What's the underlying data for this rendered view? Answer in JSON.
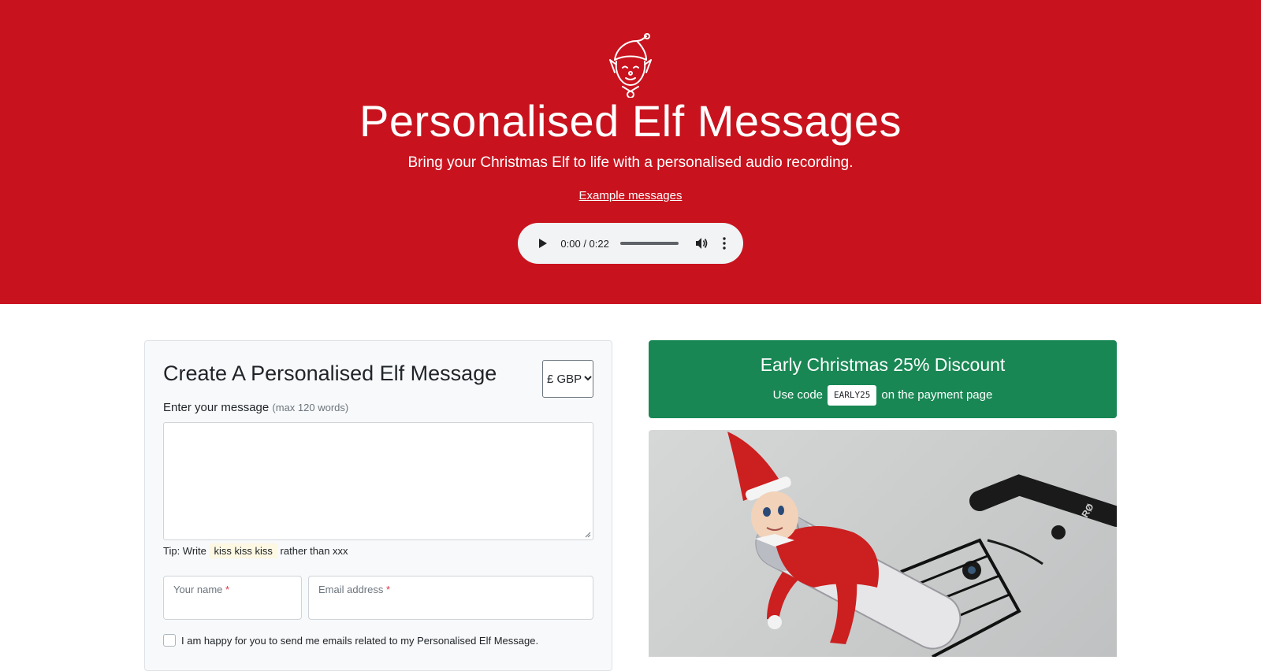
{
  "hero": {
    "title": "Personalised Elf Messages",
    "subtitle": "Bring your Christmas Elf to life with a personalised audio recording.",
    "examples_link": "Example messages",
    "background_color": "#c8131e",
    "logo_icon": "elf-face-icon"
  },
  "audio": {
    "time": "0:00 / 0:22",
    "progress": 0,
    "icons": [
      "play-icon",
      "volume-icon",
      "more-options-icon"
    ]
  },
  "form": {
    "title": "Create A Personalised Elf Message",
    "currency": "£ GBP",
    "message_label": "Enter your message",
    "message_hint": "(max 120 words)",
    "message_value": "",
    "tip_prefix": "Tip: Write",
    "tip_highlight": "kiss kiss kiss",
    "tip_suffix": "rather than xxx",
    "name_label": "Your name",
    "name_value": "",
    "email_label": "Email address",
    "email_value": "",
    "required_mark": "*",
    "consent_label": "I am happy for you to send me emails related to my Personalised Elf Message.",
    "consent_checked": false
  },
  "promo": {
    "title": "Early Christmas 25% Discount",
    "before_code": "Use code",
    "code": "EARLY25",
    "after_code": "on the payment page",
    "background_color": "#198754"
  },
  "photo": {
    "visible_text": "RØ"
  }
}
